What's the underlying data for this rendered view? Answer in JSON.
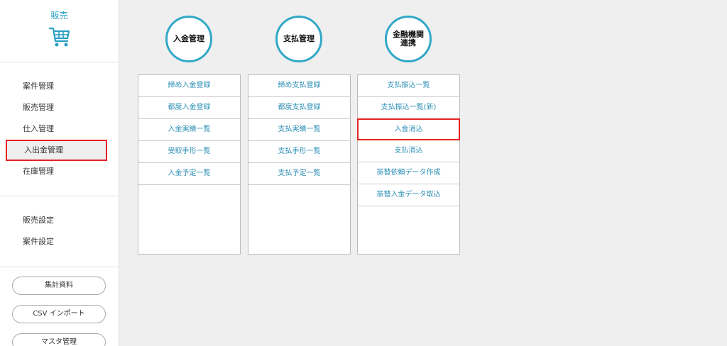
{
  "sidebar": {
    "brand_title": "販売",
    "brand_icon": "shopping-cart-icon",
    "menu": [
      "案件管理",
      "販売管理",
      "仕入管理",
      "入出金管理",
      "在庫管理"
    ],
    "active_menu_index": 3,
    "settings": [
      "販売設定",
      "案件設定"
    ],
    "buttons": [
      "集計資料",
      "CSV インポート",
      "マスタ管理"
    ]
  },
  "columns": [
    {
      "title_lines": [
        "入金管理"
      ],
      "links": [
        "締め入金登録",
        "都度入金登録",
        "入金実績一覧",
        "受取手形一覧",
        "入金予定一覧"
      ]
    },
    {
      "title_lines": [
        "支払管理"
      ],
      "links": [
        "締め支払登録",
        "都度支払登録",
        "支払実績一覧",
        "支払手形一覧",
        "支払予定一覧"
      ]
    },
    {
      "title_lines": [
        "金融機関",
        "連携"
      ],
      "links": [
        "支払振込一覧",
        "支払振込一覧(新)",
        "入金消込",
        "支払消込",
        "振替依頼データ作成",
        "振替入金データ取込"
      ],
      "active_link_index": 2
    }
  ],
  "colors": {
    "accent": "#32a8c7",
    "link": "#2a8eb5",
    "highlight": "#e52222",
    "background": "#efefef"
  }
}
